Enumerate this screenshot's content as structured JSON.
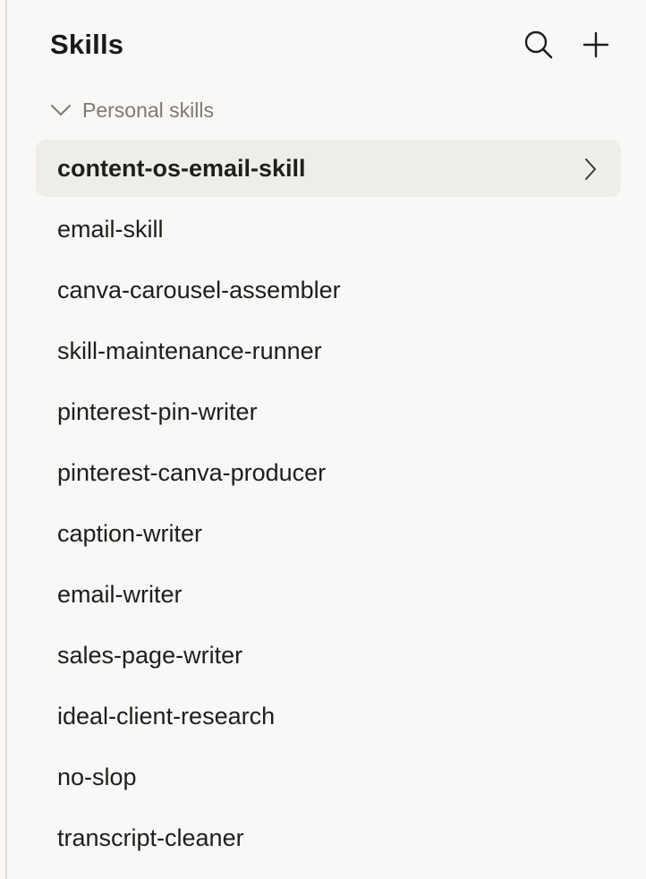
{
  "header": {
    "title": "Skills",
    "search_icon": "search-icon",
    "add_icon": "plus-icon"
  },
  "section": {
    "label": "Personal skills",
    "expanded": true,
    "chevron_icon": "chevron-down-icon"
  },
  "skills": [
    {
      "label": "content-os-email-skill",
      "selected": true
    },
    {
      "label": "email-skill",
      "selected": false
    },
    {
      "label": "canva-carousel-assembler",
      "selected": false
    },
    {
      "label": "skill-maintenance-runner",
      "selected": false
    },
    {
      "label": "pinterest-pin-writer",
      "selected": false
    },
    {
      "label": "pinterest-canva-producer",
      "selected": false
    },
    {
      "label": "caption-writer",
      "selected": false
    },
    {
      "label": "email-writer",
      "selected": false
    },
    {
      "label": "sales-page-writer",
      "selected": false
    },
    {
      "label": "ideal-client-research",
      "selected": false
    },
    {
      "label": "no-slop",
      "selected": false
    },
    {
      "label": "transcript-cleaner",
      "selected": false
    }
  ],
  "colors": {
    "background": "#f9f8f6",
    "selected_background": "#efedea",
    "text": "#1f1e1c",
    "muted_text": "#7d7a74",
    "border": "#dcdad6"
  }
}
